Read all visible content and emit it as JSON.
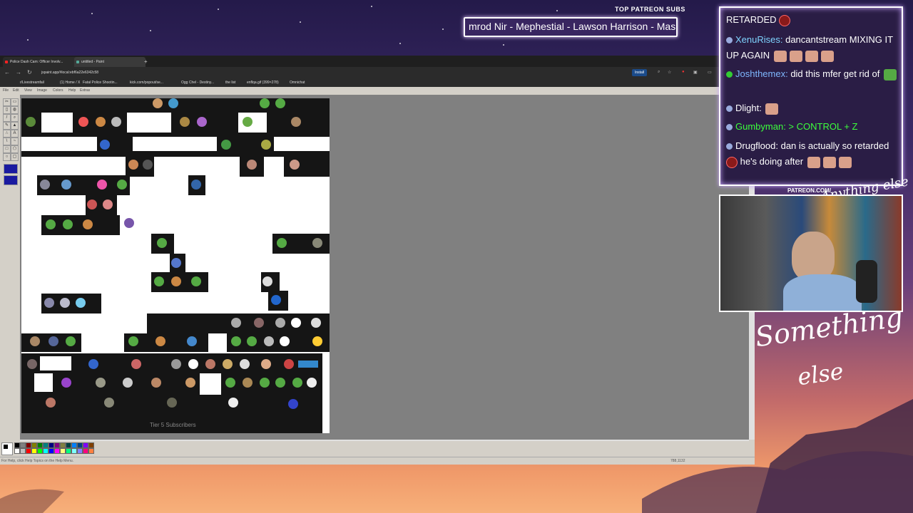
{
  "stream_overlay": {
    "patreon_label": "TOP PATREON SUBS",
    "patreon_scroll_text": "mrod Nir - Mephestial - Lawson Harrison - Mas",
    "webcam_label": "PATREON.COM/",
    "logo_line1": "Something",
    "logo_line2": "else"
  },
  "browser": {
    "tabs": [
      {
        "label": "Police Dash Cam: Officer Involv..."
      },
      {
        "label": "untitled - Paint"
      }
    ],
    "address": "jspaint.app/#local:ebf6a22e6342c58",
    "install_label": "Install",
    "bookmarks": [
      "r/Livestreamfail",
      "(1) Home / X",
      "Fatal Police Shootin...",
      "kick.com/popout/se...",
      "Ogg Chel - Destiny...",
      "the list",
      "enflqa.gif (399×278)",
      "Omnichat"
    ]
  },
  "paint": {
    "menu": [
      "File",
      "Edit",
      "View",
      "Image",
      "Colors",
      "Help",
      "Extras"
    ],
    "canvas_caption": "Tier 5 Subscribers",
    "status_text": "For Help, click Help Topics on the Help Menu.",
    "coordinates": "788,1132",
    "palette_colors": [
      "#000000",
      "#808080",
      "#800000",
      "#808000",
      "#008000",
      "#008080",
      "#000080",
      "#800080",
      "#808040",
      "#004040",
      "#0080ff",
      "#004080",
      "#8000ff",
      "#804000",
      "#ffffff",
      "#c0c0c0",
      "#ff0000",
      "#ffff00",
      "#00ff00",
      "#00ffff",
      "#0000ff",
      "#ff00ff",
      "#ffff80",
      "#00ff80",
      "#80ffff",
      "#8080ff",
      "#ff0080",
      "#ff8040"
    ]
  },
  "chat": {
    "messages": [
      {
        "user": "",
        "text": "RETARDED",
        "user_color": "#ffffff"
      },
      {
        "user": "XenuRises:",
        "text": " dancantstream MIXING IT UP AGAIN",
        "user_color": "#7fd4ff"
      },
      {
        "user": "Joshthemex:",
        "text": " did this mfer get rid of",
        "user_color": "#7fb8ff"
      },
      {
        "user": "Dlight:",
        "text": "",
        "user_color": "#ffffff"
      },
      {
        "user": "Gumbyman:",
        "text": " > CONTROL + Z",
        "user_color": "#3cff3c"
      },
      {
        "user": "Drugflood:",
        "text": " dan is actually so retarded",
        "user_color": "#ffffff"
      },
      {
        "user": "",
        "text": " he's doing after",
        "user_color": "#ffffff"
      }
    ]
  }
}
